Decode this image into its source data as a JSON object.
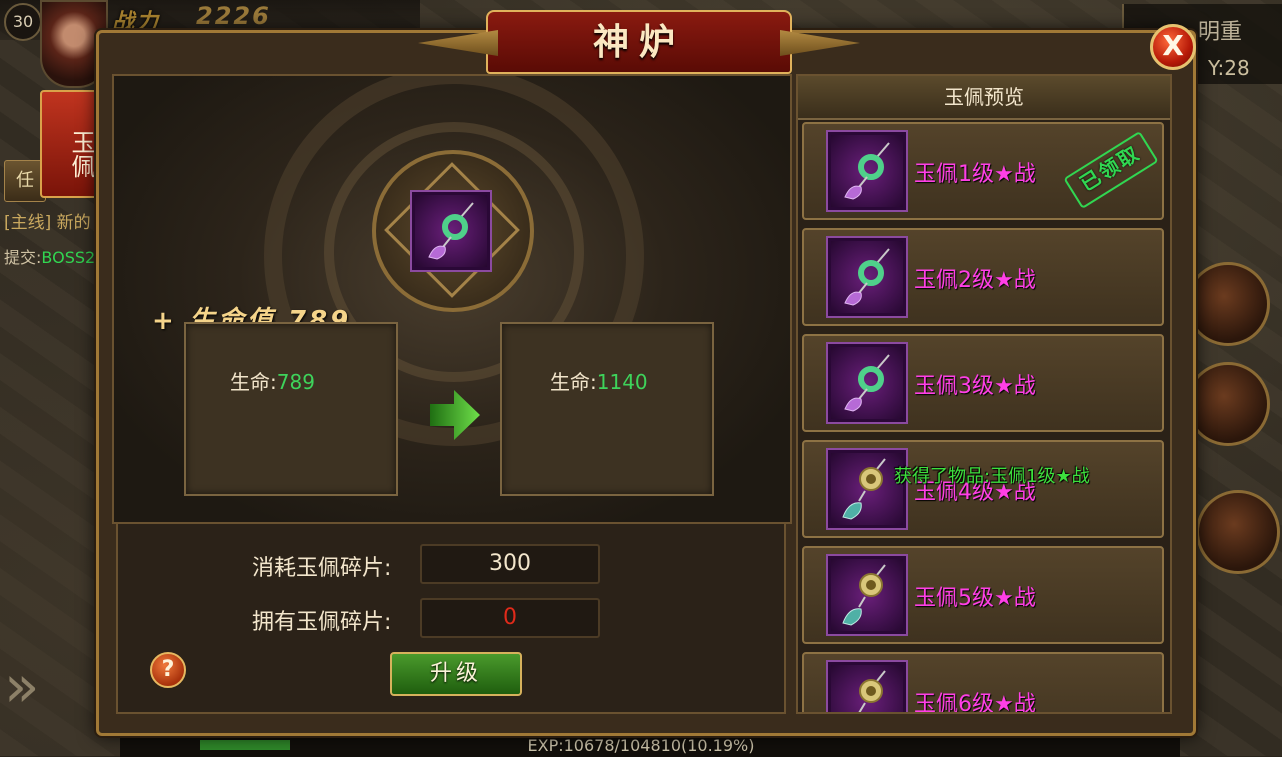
{
  "hud": {
    "level": "30",
    "power_label": "战力",
    "power_value": "2226",
    "left_tab": "玉佩",
    "left_button_stub": "任",
    "quest_line": "[主线] 新的",
    "quest_submit_label": "提交:",
    "quest_submit_target": "BOSS2",
    "coord_title": "明重",
    "coord_y": "Y:28",
    "exp_text": "EXP:10678/104810(10.19%)",
    "exp_progress_fraction": 0.1019
  },
  "dialog": {
    "title": "神炉",
    "close_label": "X",
    "bonus": "+ 生命值 789",
    "current_stat": {
      "label": "生命:",
      "value": "789"
    },
    "next_stat": {
      "label": "生命:",
      "value": "1140"
    },
    "cost_label": "消耗玉佩碎片:",
    "cost_value": "300",
    "owned_label": "拥有玉佩碎片:",
    "owned_value": "0",
    "help_label": "?",
    "upgrade_label": "升级",
    "colors": {
      "stat_value": "#3ed35b",
      "owned_insufficient": "#e02a1a",
      "item_name": "#ff3fe6"
    }
  },
  "preview": {
    "header": "玉佩预览",
    "items": [
      {
        "name": "玉佩1级★战",
        "icon": "jade-pendant-green-icon",
        "claimed": "已领取"
      },
      {
        "name": "玉佩2级★战",
        "icon": "jade-pendant-green-icon"
      },
      {
        "name": "玉佩3级★战",
        "icon": "jade-pendant-green-icon"
      },
      {
        "name": "玉佩4级★战",
        "icon": "jade-pendant-gold-icon"
      },
      {
        "name": "玉佩5级★战",
        "icon": "jade-pendant-gold-icon"
      },
      {
        "name": "玉佩6级★战",
        "icon": "jade-pendant-gold-icon"
      }
    ]
  },
  "toast": "获得了物品:玉佩1级★战"
}
